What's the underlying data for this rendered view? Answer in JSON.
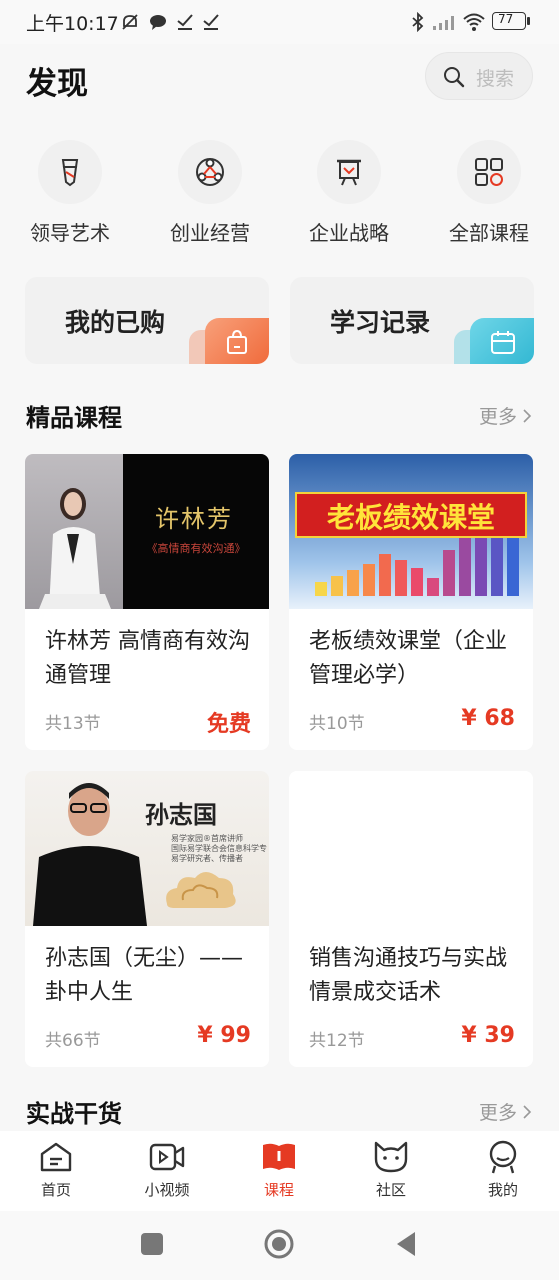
{
  "status_bar": {
    "time": "上午10:17",
    "battery": "77"
  },
  "header": {
    "title": "发现",
    "search_placeholder": "搜索"
  },
  "categories": [
    {
      "label": "领导艺术",
      "icon": "tie-icon"
    },
    {
      "label": "创业经营",
      "icon": "network-icon"
    },
    {
      "label": "企业战略",
      "icon": "presentation-icon"
    },
    {
      "label": "全部课程",
      "icon": "grid-icon"
    }
  ],
  "quick_cards": [
    {
      "label": "我的已购",
      "icon": "shopping-bag-icon",
      "color": "#f47a4e"
    },
    {
      "label": "学习记录",
      "icon": "calendar-icon",
      "color": "#3fc3db"
    }
  ],
  "sections": {
    "featured": {
      "title": "精品课程",
      "more": "更多"
    },
    "practical": {
      "title": "实战干货",
      "more": "更多"
    }
  },
  "courses": [
    {
      "title": "许林芳 高情商有效沟通管理",
      "count": "共13节",
      "price": "免费",
      "thumb_title": "许林芳",
      "thumb_subtitle": "《高情商有效沟通》"
    },
    {
      "title": "老板绩效课堂（企业管理必学）",
      "count": "共10节",
      "price": "¥ 68",
      "thumb_title": "老板绩效课堂"
    },
    {
      "title": "孙志国（无尘）——卦中人生",
      "count": "共66节",
      "price": "¥ 99",
      "thumb_title": "孙志国",
      "thumb_lines": [
        "易学家园®首席讲师",
        "国际易学联合会信息科学专",
        "易学研究者、传播者"
      ]
    },
    {
      "title": "销售沟通技巧与实战情景成交话术",
      "count": "共12节",
      "price": "¥ 39"
    }
  ],
  "bottom_nav": [
    {
      "label": "首页",
      "icon": "home-icon",
      "active": false
    },
    {
      "label": "小视频",
      "icon": "video-icon",
      "active": false
    },
    {
      "label": "课程",
      "icon": "book-icon",
      "active": true
    },
    {
      "label": "社区",
      "icon": "cat-icon",
      "active": false
    },
    {
      "label": "我的",
      "icon": "user-icon",
      "active": false
    }
  ],
  "colors": {
    "accent": "#e53a23",
    "price": "#e53a23",
    "background": "#f7f7f7"
  }
}
